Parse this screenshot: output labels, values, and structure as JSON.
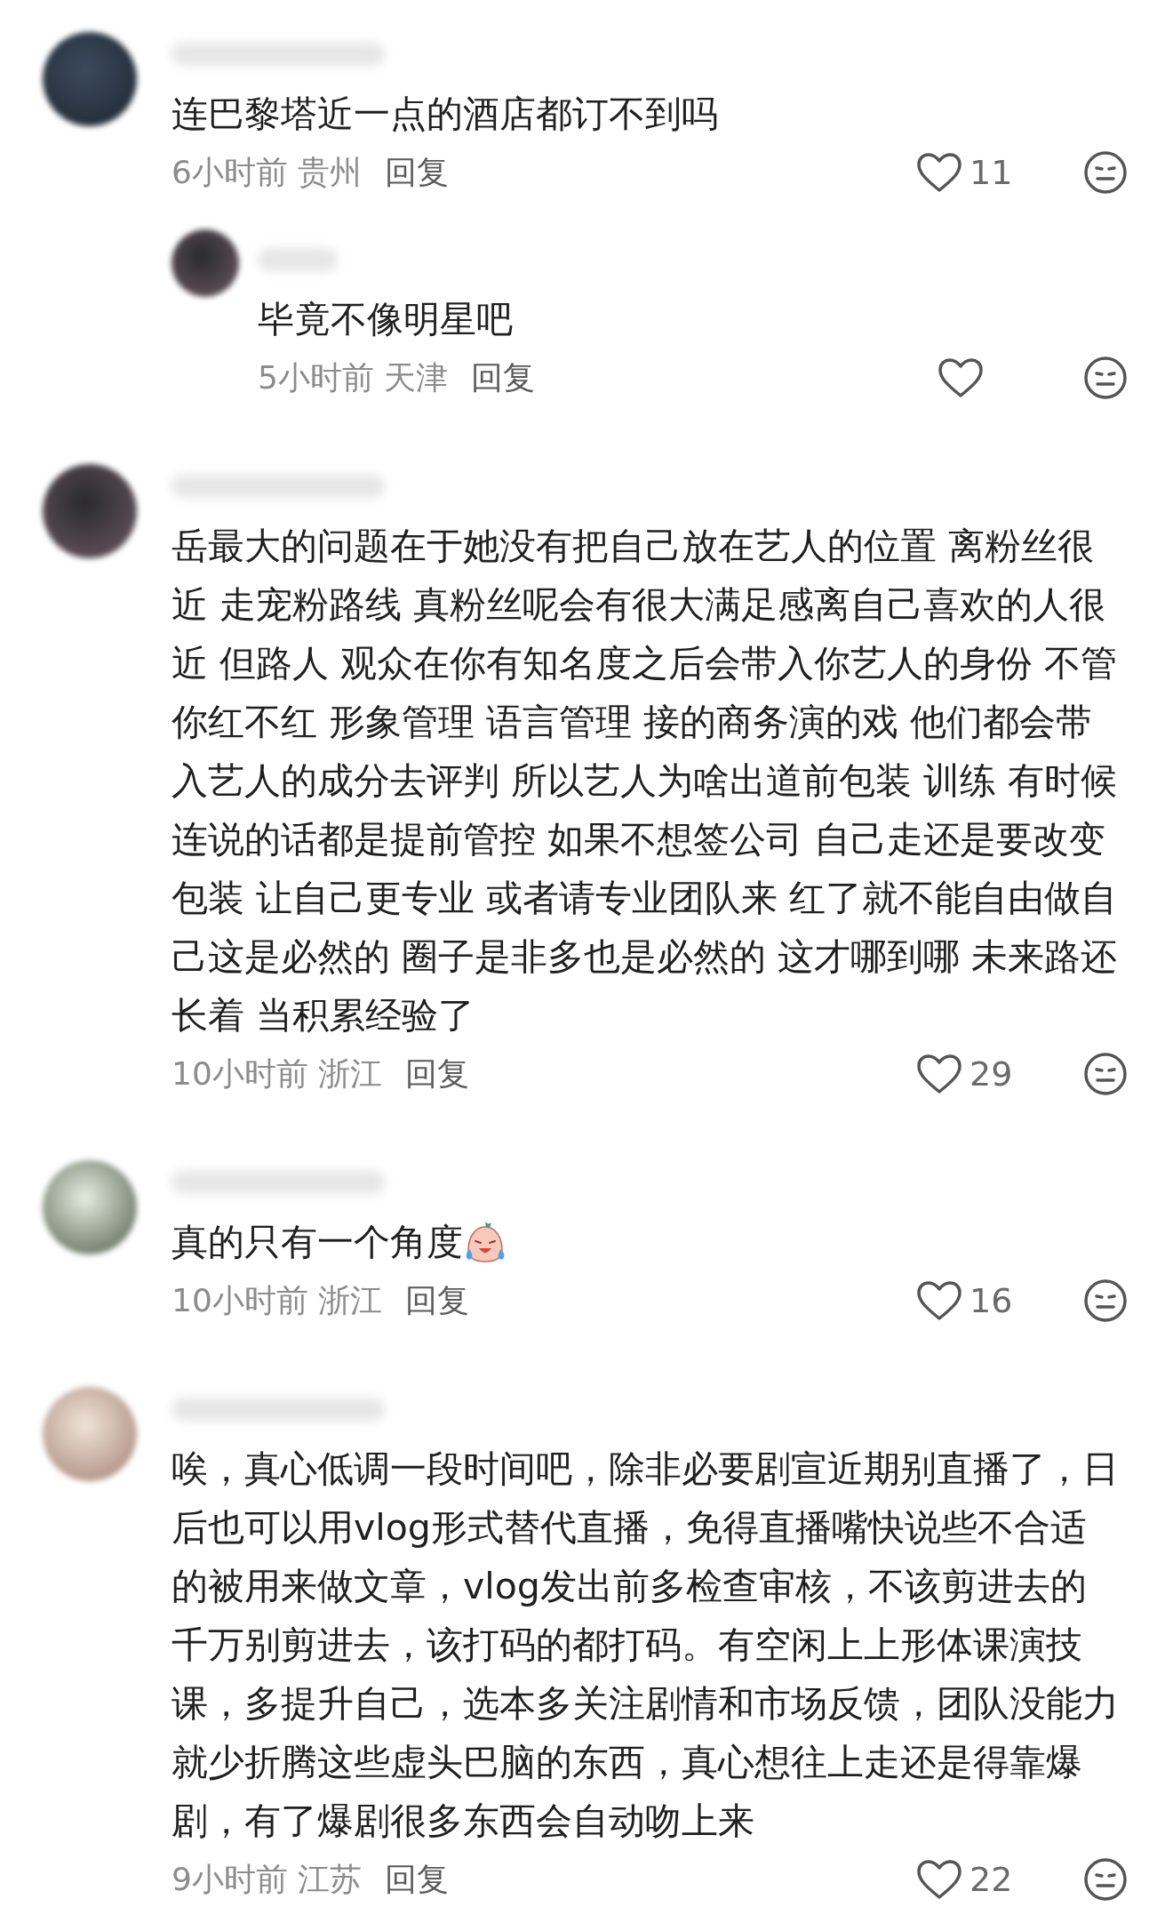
{
  "comments": [
    {
      "text": "连巴黎塔近一点的酒店都订不到吗",
      "has_emoji": false,
      "time": "6小时前",
      "location": "贵州",
      "reply": "回复",
      "likes": "11",
      "children": [
        {
          "text": "毕竟不像明星吧",
          "has_emoji": false,
          "time": "5小时前",
          "location": "天津",
          "reply": "回复"
        }
      ]
    },
    {
      "text": "岳最大的问题在于她没有把自己放在艺人的位置 离粉丝很近 走宠粉路线 真粉丝呢会有很大满足感离自己喜欢的人很近 但路人 观众在你有知名度之后会带入你艺人的身份 不管你红不红 形象管理 语言管理 接的商务演的戏 他们都会带入艺人的成分去评判 所以艺人为啥出道前包装 训练 有时候连说的话都是提前管控 如果不想签公司 自己走还是要改变包装 让自己更专业 或者请专业团队来 红了就不能自由做自己这是必然的 圈子是非多也是必然的 这才哪到哪 未来路还长着 当积累经验了",
      "has_emoji": false,
      "time": "10小时前",
      "location": "浙江",
      "reply": "回复",
      "likes": "29"
    },
    {
      "text": "真的只有一个角度",
      "has_emoji": true,
      "time": "10小时前",
      "location": "浙江",
      "reply": "回复",
      "likes": "16"
    },
    {
      "text": "唉，真心低调一段时间吧，除非必要剧宣近期别直播了，日后也可以用vlog形式替代直播，免得直播嘴快说些不合适的被用来做文章，vlog发出前多检查审核，不该剪进去的千万别剪进去，该打码的都打码。有空闲上上形体课演技课，多提升自己，选本多关注剧情和市场反馈，团队没能力就少折腾这些虚头巴脑的东西，真心想往上走还是得靠爆剧，有了爆剧很多东西会自动吻上来",
      "has_emoji": false,
      "time": "9小时前",
      "location": "江苏",
      "reply": "回复",
      "likes": "22"
    }
  ]
}
